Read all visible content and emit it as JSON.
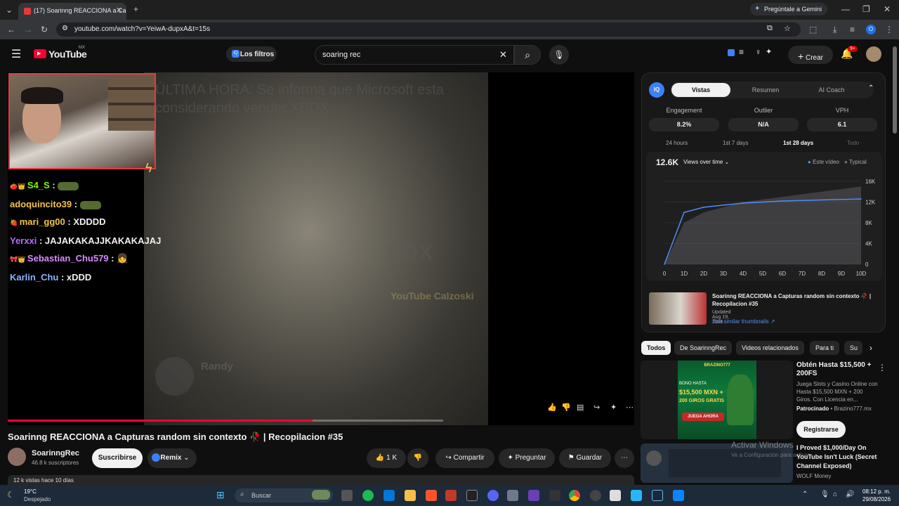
{
  "browser": {
    "tab_title": "(17) Soarinng REACCIONA a Ca",
    "url": "youtube.com/watch?v=YeiwA-dupxA&t=15s",
    "gemini_label": "Pregúntale a Gemini",
    "profile_initial": "O"
  },
  "youtube_header": {
    "logo_text": "YouTube",
    "region": "MX",
    "filters_label": "Los filtros",
    "search_value": "soaring rec",
    "create_label": "Crear",
    "notif_badge": "9+"
  },
  "video": {
    "overlay_headline": "ÚLTIMA HORA: Se informa que Microsoft esta considerando vender XBOX",
    "watermark": "YouTube Calzoski",
    "faded_user": "Randy",
    "progress_percent": 70,
    "chat": [
      {
        "user": "S4_S",
        "user_color": "#7CFC00",
        "message": ""
      },
      {
        "user": "adoquincito39",
        "user_color": "#f4c542",
        "message": ""
      },
      {
        "user": "mari_gg00",
        "user_color": "#f4c542",
        "message": "XDDDD"
      },
      {
        "user": "Yerxxi",
        "user_color": "#b56cff",
        "message": "JAJAKAKAJJKAKAKAJAJ"
      },
      {
        "user": "Sebastian_Chu579",
        "user_color": "#d88cff",
        "message": ""
      },
      {
        "user": "Karlin_Chu",
        "user_color": "#8ab4ff",
        "message": "xDDD"
      }
    ]
  },
  "below_video": {
    "title": "Soarinng REACCIONA a Capturas random sin contexto 🥀 | Recopilacion #35",
    "channel": "SoarinngRec",
    "subscribers": "46.8 k suscriptores",
    "subscribe_label": "Suscribirse",
    "remix_label": "Remix",
    "likes": "1 K",
    "share_label": "Compartir",
    "ask_label": "Preguntar",
    "save_label": "Guardar",
    "views_line": "12 k vistas  hace 10 días"
  },
  "panel": {
    "tabs": [
      "Vistas",
      "Resumen",
      "AI Coach"
    ],
    "metrics": [
      {
        "label": "Engagement",
        "value": "8.2%"
      },
      {
        "label": "Outlier",
        "value": "N/A"
      },
      {
        "label": "VPH",
        "value": "6.1"
      }
    ],
    "periods": [
      "24 hours",
      "1st 7 days",
      "1st 28 days",
      "Todo"
    ],
    "active_period": "1st 28 days",
    "total_views": "12.6K",
    "dropdown_label": "Views over time",
    "legend": [
      "Este vídeo",
      "Typical"
    ],
    "rec_title": "Soarinng REACCIONA a Capturas random sin contexto 🥀 | Recopilacion #35",
    "rec_updated": "Updated Aug 19, 2026",
    "rec_link": "See similar thumbnails ↗"
  },
  "chart_data": {
    "type": "area",
    "x": [
      "0",
      "1D",
      "2D",
      "3D",
      "4D",
      "5D",
      "6D",
      "7D",
      "8D",
      "9D",
      "10D"
    ],
    "yticks": [
      "16K",
      "12K",
      "8K",
      "4K",
      "0"
    ],
    "ylim": [
      0,
      16000
    ],
    "series": [
      {
        "name": "Este vídeo",
        "values": [
          0,
          10000,
          11000,
          11400,
          11800,
          12000,
          12200,
          12300,
          12400,
          12500,
          12600
        ]
      },
      {
        "name": "Typical",
        "values": [
          0,
          8000,
          10000,
          11000,
          12000,
          12500,
          13000,
          13500,
          14000,
          14500,
          15000
        ]
      }
    ]
  },
  "chips": [
    "Todos",
    "De SoarinngRec",
    "Videos relacionados",
    "Para ti",
    "Su"
  ],
  "ad": {
    "title": "Obtén Hasta $15,500 + 200FS",
    "desc": "Juega Slots y Casino Online con Hasta $15,500 MXN + 200 Giros. Con Licencia en...",
    "sponsored": "Patrocinado",
    "advertiser": "Brazino777.mx",
    "cta": "Registrarse",
    "banner_brand": "BRAZINO777",
    "banner_line1": "BONO HASTA",
    "banner_line2": "$15,500 MXN +",
    "banner_line3": "200 GIROS GRATIS",
    "banner_cta": "JUEGA AHORA"
  },
  "next_video": {
    "title": "I Proved $1,000/Day On YouTube Isn't Luck (Secret Channel Exposed)",
    "channel": "WOLF Money",
    "activate_overlay": "Activar Windows",
    "activate_sub": "Ve a Configuración para activar"
  },
  "taskbar": {
    "temp": "19°C",
    "weather": "Despejado",
    "search_placeholder": "Buscar",
    "time": "08:12 p. m.",
    "date": "29/08/2026"
  }
}
